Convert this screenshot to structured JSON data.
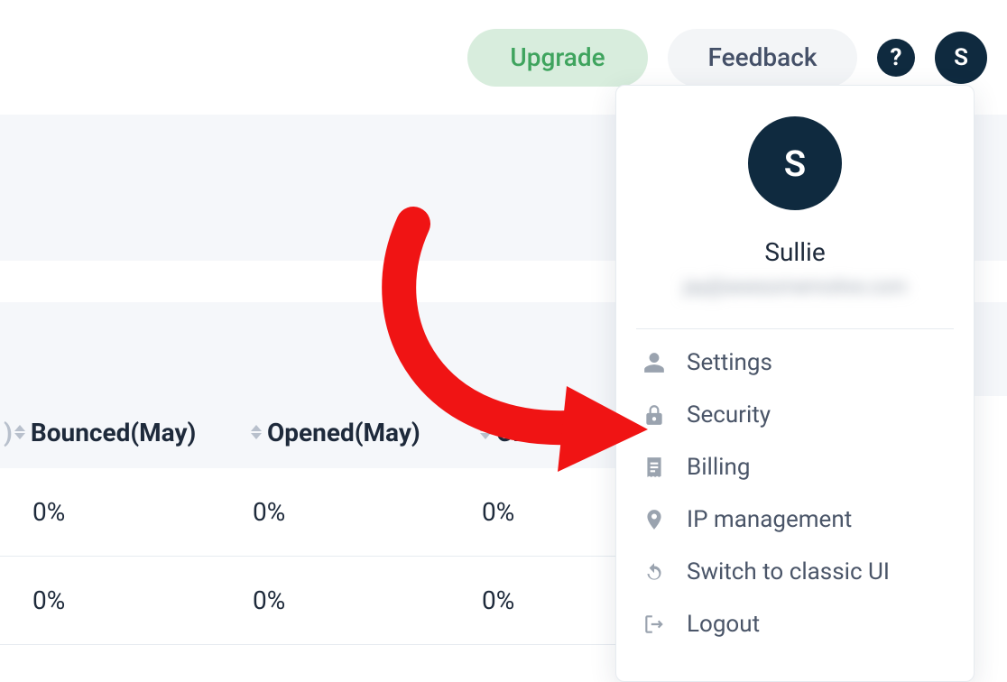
{
  "topbar": {
    "upgrade_label": "Upgrade",
    "feedback_label": "Feedback",
    "help_glyph": "?",
    "avatar_initial": "S"
  },
  "table": {
    "columns": [
      {
        "label": "Bounced(May)",
        "lead_paren": ")"
      },
      {
        "label": "Opened(May)"
      },
      {
        "label": "Click"
      }
    ],
    "rows": [
      [
        "0%",
        "0%",
        "0%"
      ],
      [
        "0%",
        "0%",
        "0%"
      ]
    ]
  },
  "dropdown": {
    "avatar_initial": "S",
    "name": "Sullie",
    "email_placeholder": "jay@awesomemotive.com",
    "items": [
      {
        "icon": "person",
        "label": "Settings"
      },
      {
        "icon": "lock",
        "label": "Security"
      },
      {
        "icon": "receipt",
        "label": "Billing"
      },
      {
        "icon": "pin",
        "label": "IP management"
      },
      {
        "icon": "refresh",
        "label": "Switch to classic UI"
      },
      {
        "icon": "logout",
        "label": "Logout"
      }
    ]
  }
}
